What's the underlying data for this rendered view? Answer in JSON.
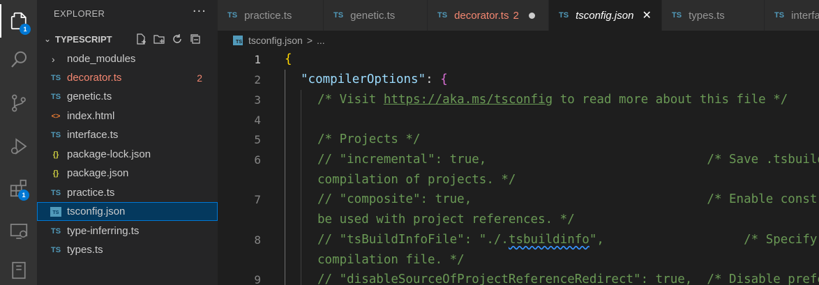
{
  "activity_bar": {
    "items": [
      {
        "icon": "explorer-icon",
        "badge": "1"
      },
      {
        "icon": "search-icon"
      },
      {
        "icon": "source-control-icon"
      },
      {
        "icon": "run-debug-icon"
      },
      {
        "icon": "extensions-icon",
        "badge": "1"
      },
      {
        "icon": "remote-explorer-icon"
      },
      {
        "icon": "notebook-icon"
      }
    ]
  },
  "sidebar": {
    "title": "EXPLORER",
    "more": "···",
    "section": "TYPESCRIPT",
    "files": [
      {
        "name": "node_modules",
        "type": "folder"
      },
      {
        "name": "decorator.ts",
        "type": "ts",
        "error_count": "2"
      },
      {
        "name": "genetic.ts",
        "type": "ts"
      },
      {
        "name": "index.html",
        "type": "html"
      },
      {
        "name": "interface.ts",
        "type": "ts"
      },
      {
        "name": "package-lock.json",
        "type": "json"
      },
      {
        "name": "package.json",
        "type": "json"
      },
      {
        "name": "practice.ts",
        "type": "ts"
      },
      {
        "name": "tsconfig.json",
        "type": "ts",
        "selected": true
      },
      {
        "name": "type-inferring.ts",
        "type": "ts"
      },
      {
        "name": "types.ts",
        "type": "ts"
      }
    ]
  },
  "tabs": [
    {
      "label": "practice.ts",
      "icon": "TS"
    },
    {
      "label": "genetic.ts",
      "icon": "TS"
    },
    {
      "label": "decorator.ts",
      "icon": "TS",
      "count": "2",
      "dirty": true
    },
    {
      "label": "tsconfig.json",
      "icon": "TS",
      "active": true
    },
    {
      "label": "types.ts",
      "icon": "TS"
    },
    {
      "label": "interface.ts",
      "icon": "TS"
    }
  ],
  "breadcrumb": {
    "file": "tsconfig.json",
    "separator": ">",
    "more": "..."
  },
  "editor": {
    "line_numbers": [
      "1",
      "2",
      "3",
      "4",
      "5",
      "6",
      "",
      "7",
      "",
      "8",
      "",
      "9"
    ],
    "code": {
      "l1": "{",
      "l2_key": "\"compilerOptions\"",
      "l2_colon": ": ",
      "l2_brace": "{",
      "l3_a": "/* Visit ",
      "l3_link": "https://aka.ms/tsconfig",
      "l3_b": " to read more about this file */",
      "l5": "/* Projects */",
      "l6": "// \"incremental\": true,                              /* Save .tsbuildinfo files to allow for incremental",
      "l6b": "compilation of projects. */",
      "l7": "// \"composite\": true,                                /* Enable constraints that allow a TypeScript project to",
      "l7b": "be used with project references. */",
      "l8_a": "// \"tsBuildInfoFile\": \"./.",
      "l8_sq": "tsbuildinfo",
      "l8_b": "\",                   /* Specify the path to .tsbuildinfo incremental",
      "l8b": "compilation file. */",
      "l9": "// \"disableSourceOfProjectReferenceRedirect\": true,  /* Disable preferring source files instead of declaration"
    }
  }
}
